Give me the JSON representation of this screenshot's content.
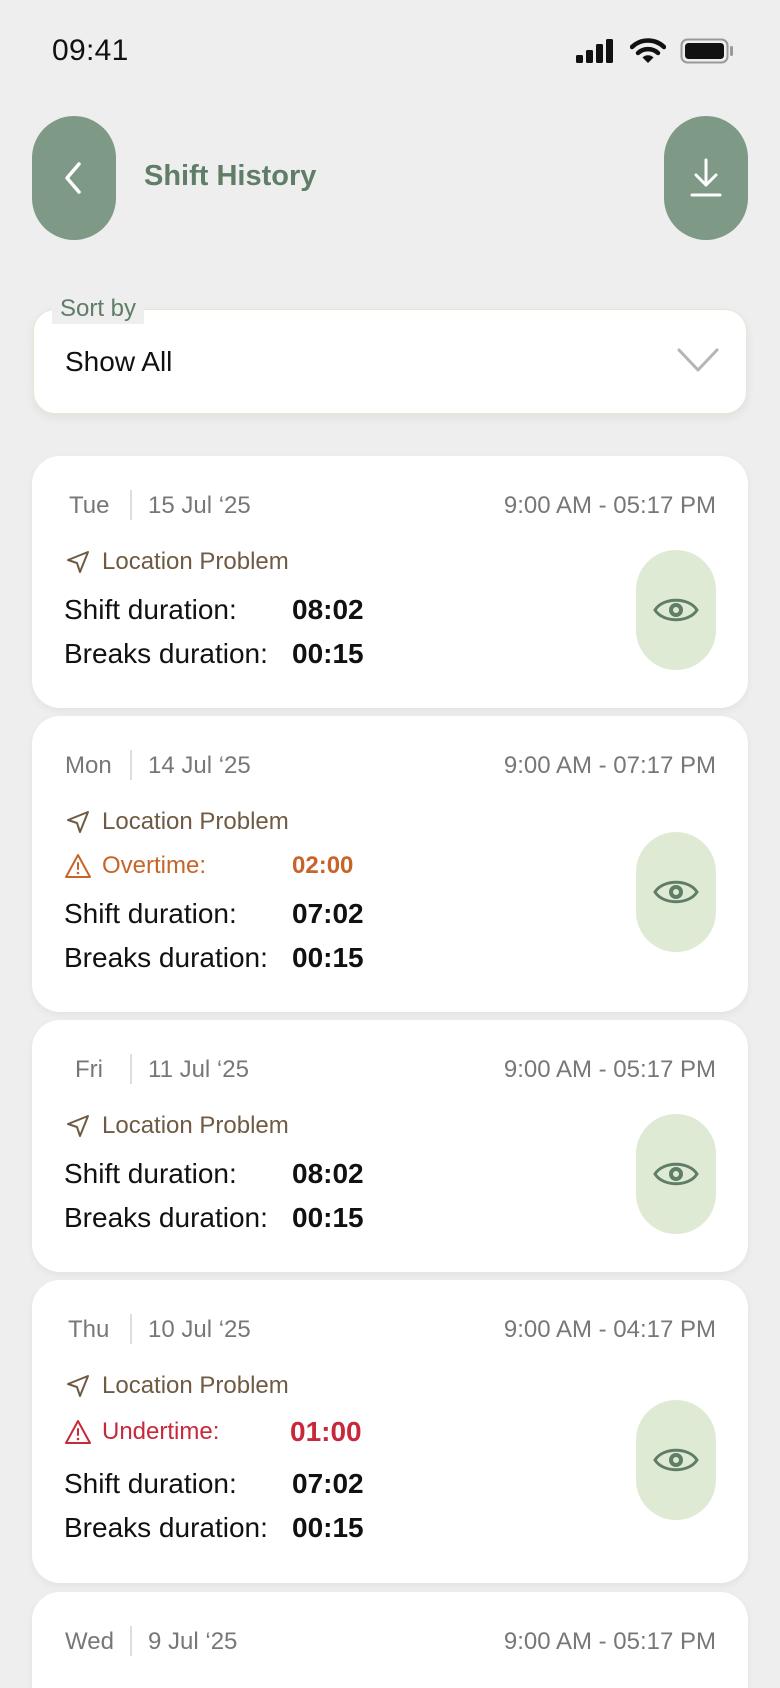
{
  "status_bar": {
    "time": "09:41"
  },
  "header": {
    "title": "Shift History"
  },
  "sort": {
    "label": "Sort by",
    "value": "Show All"
  },
  "labels": {
    "location_problem": "Location Problem",
    "overtime": "Overtime:",
    "undertime": "Undertime:",
    "shift_duration": "Shift duration:",
    "breaks_duration": "Breaks duration:"
  },
  "shifts": [
    {
      "day": "Tue",
      "date": "15 Jul ‘25",
      "time_range": "9:00 AM - 05:17 PM",
      "location_problem": true,
      "shift_duration": "08:02",
      "breaks_duration": "00:15"
    },
    {
      "day": "Mon",
      "date": "14 Jul ‘25",
      "time_range": "9:00 AM - 07:17 PM",
      "location_problem": true,
      "overtime": "02:00",
      "shift_duration": "07:02",
      "breaks_duration": "00:15"
    },
    {
      "day": "Fri",
      "date": "11 Jul ‘25",
      "time_range": "9:00 AM - 05:17 PM",
      "location_problem": true,
      "shift_duration": "08:02",
      "breaks_duration": "00:15"
    },
    {
      "day": "Thu",
      "date": "10 Jul ‘25",
      "time_range": "9:00 AM - 04:17 PM",
      "location_problem": true,
      "undertime": "01:00",
      "shift_duration": "07:02",
      "breaks_duration": "00:15"
    },
    {
      "day": "Wed",
      "date": "9 Jul ‘25",
      "time_range": "9:00 AM - 05:17 PM"
    }
  ],
  "icons": {
    "back": "chevron-left-icon",
    "download": "download-icon",
    "sort": "chevron-down-icon",
    "location": "navigation-arrow-icon",
    "warning": "warning-triangle-icon",
    "view": "eye-icon"
  },
  "colors": {
    "primary": "#7e9985",
    "title": "#5f7d67",
    "eye_button": "#dfead4",
    "location_text": "#6f5a43",
    "overtime": "#c7642a",
    "undertime": "#c8283a"
  }
}
